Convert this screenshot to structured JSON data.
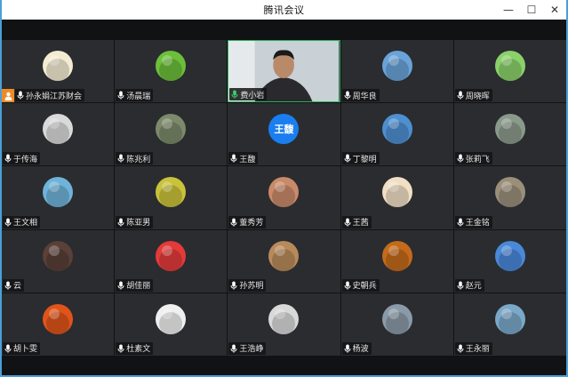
{
  "window": {
    "title": "腾讯会议",
    "controls": {
      "minimize": "—",
      "maximize": "☐",
      "close": "✕"
    }
  },
  "colors": {
    "accent_speaking": "#27b35a",
    "host_badge": "#f08a24",
    "mic_icon": "#ffffff",
    "name_tag_bg": "#141416"
  },
  "participants": [
    {
      "name": "孙永娟江苏财会",
      "avatar_icon": "pin-avatar-icon",
      "avatar_color": "#f4ecd2",
      "host": true
    },
    {
      "name": "汤晨瑞",
      "avatar_icon": "leaf-avatar-icon",
      "avatar_color": "#6cbf3a"
    },
    {
      "name": "费小岩",
      "avatar_icon": "video-feed",
      "video": true,
      "mic": "active"
    },
    {
      "name": "周华良",
      "avatar_icon": "sky-avatar-icon",
      "avatar_color": "#6aa3d8"
    },
    {
      "name": "周晓晖",
      "avatar_icon": "cartoon-avatar-icon",
      "avatar_color": "#8bd16a"
    },
    {
      "name": "于传海",
      "avatar_icon": "dog-avatar-icon",
      "avatar_color": "#d9d9d9"
    },
    {
      "name": "陈兆利",
      "avatar_icon": "tree-avatar-icon",
      "avatar_color": "#7c8a6a"
    },
    {
      "name": "王馥",
      "avatar_icon": "text-avatar-icon",
      "avatar_text": "王馥",
      "avatar_color": "#1a7ef0"
    },
    {
      "name": "丁黎明",
      "avatar_icon": "landscape-avatar-icon",
      "avatar_color": "#4d8fd0"
    },
    {
      "name": "张莉飞",
      "avatar_icon": "person-avatar-icon",
      "avatar_color": "#8a9a8a"
    },
    {
      "name": "王文相",
      "avatar_icon": "beach-avatar-icon",
      "avatar_color": "#6fb3d9"
    },
    {
      "name": "陈亚男",
      "avatar_icon": "flower-avatar-icon",
      "avatar_color": "#c9c23a"
    },
    {
      "name": "董秀芳",
      "avatar_icon": "drawing-avatar-icon",
      "avatar_color": "#c98a6a"
    },
    {
      "name": "王茜",
      "avatar_icon": "girl-avatar-icon",
      "avatar_color": "#f0dfc4"
    },
    {
      "name": "王金铭",
      "avatar_icon": "photo-avatar-icon",
      "avatar_color": "#9b8f7a"
    },
    {
      "name": "云",
      "avatar_icon": "woman-avatar-icon",
      "avatar_color": "#5a4038"
    },
    {
      "name": "胡佳丽",
      "avatar_icon": "cartoon-girl-avatar-icon",
      "avatar_color": "#e33a3a"
    },
    {
      "name": "孙苏明",
      "avatar_icon": "town-avatar-icon",
      "avatar_color": "#b88a5a"
    },
    {
      "name": "史朝兵",
      "avatar_icon": "interior-avatar-icon",
      "avatar_color": "#c46a1a"
    },
    {
      "name": "赵元",
      "avatar_icon": "ocean-avatar-icon",
      "avatar_color": "#4a88d8"
    },
    {
      "name": "胡卜雯",
      "avatar_icon": "sunflower-avatar-icon",
      "avatar_color": "#e0541a"
    },
    {
      "name": "杜素文",
      "avatar_icon": "sketch-avatar-icon",
      "avatar_color": "#efefef"
    },
    {
      "name": "王浩峥",
      "avatar_icon": "bw-cartoon-avatar-icon",
      "avatar_color": "#d8d8d8"
    },
    {
      "name": "杨波",
      "avatar_icon": "lake-avatar-icon",
      "avatar_color": "#8a9aa8"
    },
    {
      "name": "王永丽",
      "avatar_icon": "kids-avatar-icon",
      "avatar_color": "#7aa8c8"
    }
  ]
}
